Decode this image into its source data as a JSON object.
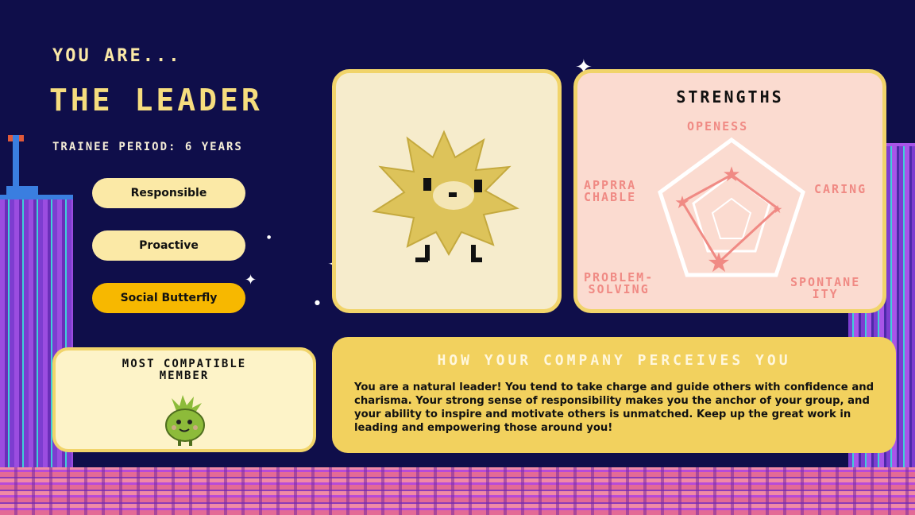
{
  "header": {
    "intro": "YOU ARE...",
    "title": "THE LEADER",
    "trainee_period": "TRAINEE PERIOD: 6 YEARS"
  },
  "traits": [
    {
      "label": "Responsible",
      "highlighted": false
    },
    {
      "label": "Proactive",
      "highlighted": false
    },
    {
      "label": "Social Butterfly",
      "highlighted": true
    }
  ],
  "compatible": {
    "title_line1": "MOST COMPATIBLE",
    "title_line2": "MEMBER",
    "avatar": "green-sprout-creature-icon"
  },
  "character": {
    "avatar": "yellow-star-creature-icon"
  },
  "strengths": {
    "title": "STRENGTHS",
    "axes": {
      "top": "OPENESS",
      "right": "CARING",
      "bottom_right_line1": "SPONTANE",
      "bottom_right_line2": "ITY",
      "bottom_left_line1": "PROBLEM-",
      "bottom_left_line2": "SOLVING",
      "left_line1": "APPRRA",
      "left_line2": "CHABLE"
    }
  },
  "perception": {
    "title": "HOW YOUR COMPANY PERCEIVES YOU",
    "body": "You are a natural leader! You tend to take charge and guide others with confidence and charisma. Your strong sense of responsibility makes you the anchor of your group, and your ability to inspire and motivate others is unmatched. Keep up the great work in leading and empowering those around you!"
  },
  "colors": {
    "background": "#0f0e4a",
    "card_border": "#f1d46a",
    "trait_fill": "#fbe9a6",
    "trait_highlight": "#f7b800",
    "strength_accent": "#f08a84"
  }
}
